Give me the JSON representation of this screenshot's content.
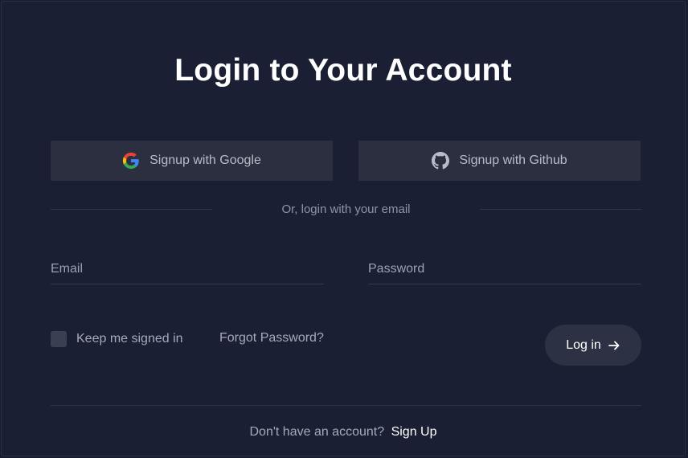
{
  "login": {
    "title": "Login to Your Account",
    "social": {
      "google_label": "Signup with Google",
      "github_label": "Signup with Github"
    },
    "divider_text": "Or, login with your email",
    "email": {
      "placeholder": "Email",
      "value": ""
    },
    "password": {
      "placeholder": "Password",
      "value": ""
    },
    "remember_label": "Keep me signed in",
    "remember_checked": false,
    "forgot_label": "Forgot Password?",
    "submit_label": "Log in",
    "signup_prompt": "Don't have an account?",
    "signup_link": "Sign Up"
  },
  "icons": {
    "google": "google-logo-icon",
    "github": "github-logo-icon",
    "submit_arrow": "arrow-right-icon"
  },
  "colors": {
    "background": "#1b1f33",
    "button": "#2b2f3f",
    "primary_text": "#ffffff",
    "muted_text": "#a5aabb"
  }
}
